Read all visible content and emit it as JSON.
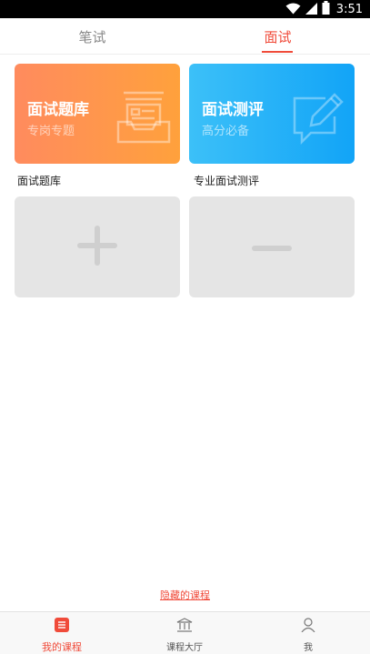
{
  "status_bar": {
    "time": "3:51"
  },
  "tabs": [
    {
      "label": "笔试",
      "active": false
    },
    {
      "label": "面试",
      "active": true
    }
  ],
  "cards": [
    {
      "title": "面试题库",
      "subtitle": "专岗专题",
      "caption": "面试题库",
      "color": "#ff9a48",
      "icon": "inbox-documents-icon"
    },
    {
      "title": "面试测评",
      "subtitle": "高分必备",
      "caption": "专业面试测评",
      "color": "#1aa8f7",
      "icon": "edit-comment-icon"
    }
  ],
  "actions": {
    "add_icon": "plus-icon",
    "remove_icon": "minus-icon"
  },
  "hidden_courses_link": "隐藏的课程",
  "bottom_nav": [
    {
      "label": "我的课程",
      "icon": "my-courses-icon",
      "active": true
    },
    {
      "label": "课程大厅",
      "icon": "course-hall-icon",
      "active": false
    },
    {
      "label": "我",
      "icon": "profile-icon",
      "active": false
    }
  ],
  "colors": {
    "accent": "#f04b3a",
    "orange": "#ff9a48",
    "blue": "#1aa8f7",
    "tile": "#e5e5e5"
  }
}
